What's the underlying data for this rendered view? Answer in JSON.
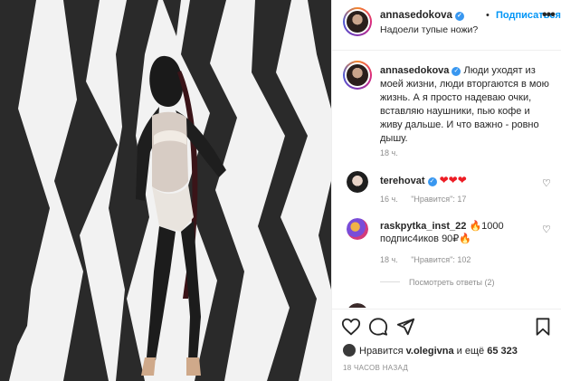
{
  "post": {
    "username": "annasedokova",
    "follow_label": "Подписаться",
    "location": "Надоели тупые ножи?",
    "more_label": "•••",
    "separator": "•"
  },
  "caption": {
    "username": "annasedokova",
    "text": "Люди уходят из моей жизни, люди вторгаются в мою жизнь. А я просто надеваю очки, вставляю наушники, пью кофе и живу дальше. И что важно - ровно дышу.",
    "time": "18 ч."
  },
  "comments": [
    {
      "username": "terehovat",
      "text": "❤❤❤",
      "time": "16 ч.",
      "likes": "\"Нравится\": 17"
    },
    {
      "username": "raskpytka_inst_22",
      "text": "🔥1000 подпис4иков 90₽🔥",
      "time": "18 ч.",
      "likes": "\"Нравится\": 102",
      "view_replies": "Посмотреть ответы (2)"
    }
  ],
  "footer": {
    "liked_by_prefix": "Нравится",
    "liked_by_user": "v.olegivna",
    "liked_by_mid": "и ещё",
    "liked_by_count": "65 323",
    "posted_time": "18 ЧАСОВ НАЗАД"
  },
  "icons": {
    "like": "heart-outline-icon",
    "comment": "speech-bubble-icon",
    "share": "paper-plane-icon",
    "save": "bookmark-icon",
    "verified": "verified-badge-icon"
  },
  "colors": {
    "link": "#0095f6",
    "verified": "#3897f0",
    "muted": "#8e8e8e",
    "text": "#262626"
  }
}
